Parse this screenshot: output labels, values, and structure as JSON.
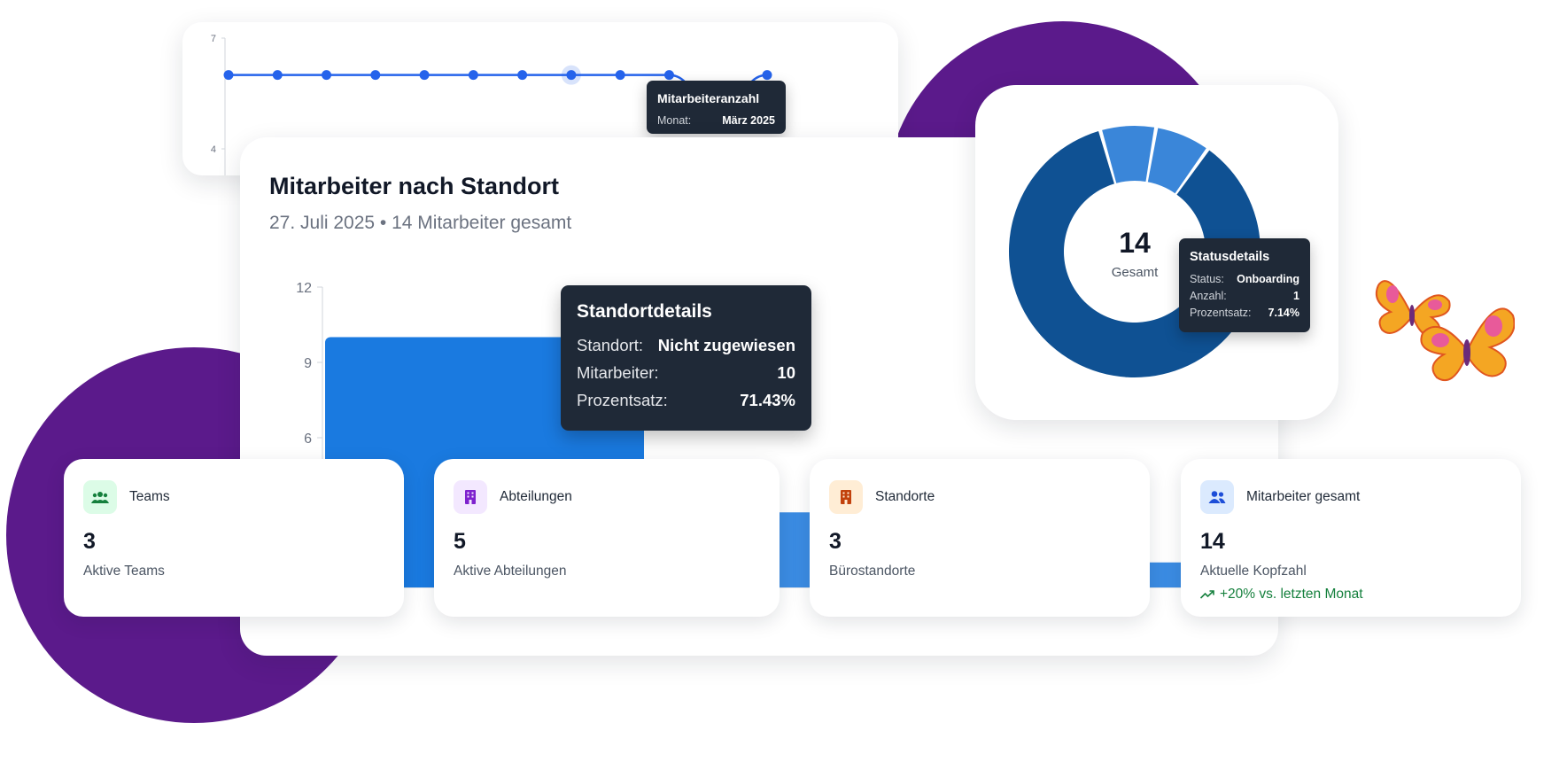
{
  "line_chart": {
    "y_ticks": [
      "7",
      "4"
    ],
    "ylim": [
      4,
      7
    ],
    "values": [
      6,
      6,
      6,
      6,
      6,
      6,
      6,
      6,
      6,
      6,
      5,
      6
    ],
    "highlight_index": 7,
    "color": "#2563eb",
    "tooltip": {
      "title": "Mitarbeiteranzahl",
      "label": "Monat:",
      "value": "März 2025"
    }
  },
  "bar_chart": {
    "title": "Mitarbeiter nach Standort",
    "subtitle": "27. Juli 2025 • 14 Mitarbeiter gesamt",
    "y_ticks": [
      "12",
      "9",
      "6"
    ],
    "ylim": [
      0,
      12
    ],
    "bar_color": "#1a7ae0",
    "tooltip": {
      "title": "Standortdetails",
      "rows": [
        {
          "label": "Standort:",
          "value": "Nicht zugewiesen"
        },
        {
          "label": "Mitarbeiter:",
          "value": "10"
        },
        {
          "label": "Prozentsatz:",
          "value": "71.43%"
        }
      ]
    }
  },
  "donut_chart": {
    "center_value": "14",
    "center_label": "Gesamt",
    "slices": [
      {
        "value": 12,
        "color": "#0f5193"
      },
      {
        "value": 1,
        "color": "#3a86d9"
      },
      {
        "value": 1,
        "color": "#3a86d9"
      }
    ],
    "tooltip": {
      "title": "Statusdetails",
      "rows": [
        {
          "label": "Status:",
          "value": "Onboarding"
        },
        {
          "label": "Anzahl:",
          "value": "1"
        },
        {
          "label": "Prozentsatz:",
          "value": "7.14%"
        }
      ]
    }
  },
  "chart_data": {
    "type": "bar",
    "title": "Mitarbeiter nach Standort",
    "subtitle": "27. Juli 2025 • 14 Mitarbeiter gesamt",
    "categories": [
      "Nicht zugewiesen",
      "",
      ""
    ],
    "values": [
      10,
      3,
      1
    ],
    "ylim": [
      0,
      12
    ],
    "y_ticks": [
      6,
      9,
      12
    ]
  },
  "stats": [
    {
      "icon": "users-icon",
      "label": "Teams",
      "value": "3",
      "desc": "Aktive Teams",
      "icon_bg": "#dcfce7",
      "icon_color": "#15803d"
    },
    {
      "icon": "building-icon",
      "label": "Abteilungen",
      "value": "5",
      "desc": "Aktive Abteilungen",
      "icon_bg": "#f3e8ff",
      "icon_color": "#7e22ce"
    },
    {
      "icon": "building-icon",
      "label": "Standorte",
      "value": "3",
      "desc": "Bürostandorte",
      "icon_bg": "#ffedd5",
      "icon_color": "#c2410c"
    },
    {
      "icon": "people-icon",
      "label": "Mitarbeiter gesamt",
      "value": "14",
      "desc": "Aktuelle Kopfzahl",
      "trend": "+20% vs. letzten Monat",
      "icon_bg": "#dbeafe",
      "icon_color": "#1d4ed8"
    }
  ],
  "colors": {
    "blob": "#5b1a8b",
    "trend_positive": "#15803d"
  }
}
